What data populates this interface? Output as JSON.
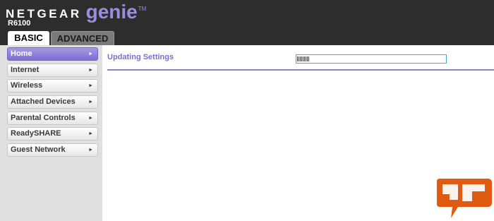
{
  "header": {
    "brand_netgear": "NETGEAR",
    "brand_genie": "genie",
    "brand_tm": "TM",
    "model": "R6100"
  },
  "tabs": [
    {
      "label": "BASIC",
      "active": true
    },
    {
      "label": "ADVANCED",
      "active": false
    }
  ],
  "sidebar": {
    "items": [
      {
        "label": "Home",
        "active": true
      },
      {
        "label": "Internet",
        "active": false
      },
      {
        "label": "Wireless",
        "active": false
      },
      {
        "label": "Attached Devices",
        "active": false
      },
      {
        "label": "Parental Controls",
        "active": false
      },
      {
        "label": "ReadySHARE",
        "active": false
      },
      {
        "label": "Guest Network",
        "active": false
      }
    ]
  },
  "main": {
    "status_label": "Updating Settings",
    "progress_fraction": 0.08
  },
  "colors": {
    "header_bg": "#2d2d2d",
    "accent": "#7a6dd4",
    "progress_border": "#3bb0c9",
    "sidebar_bg": "#e0e0e0"
  },
  "icons": {
    "nav_arrow": "right-triangle-icon",
    "watermark": "speech-bubble-logo"
  }
}
